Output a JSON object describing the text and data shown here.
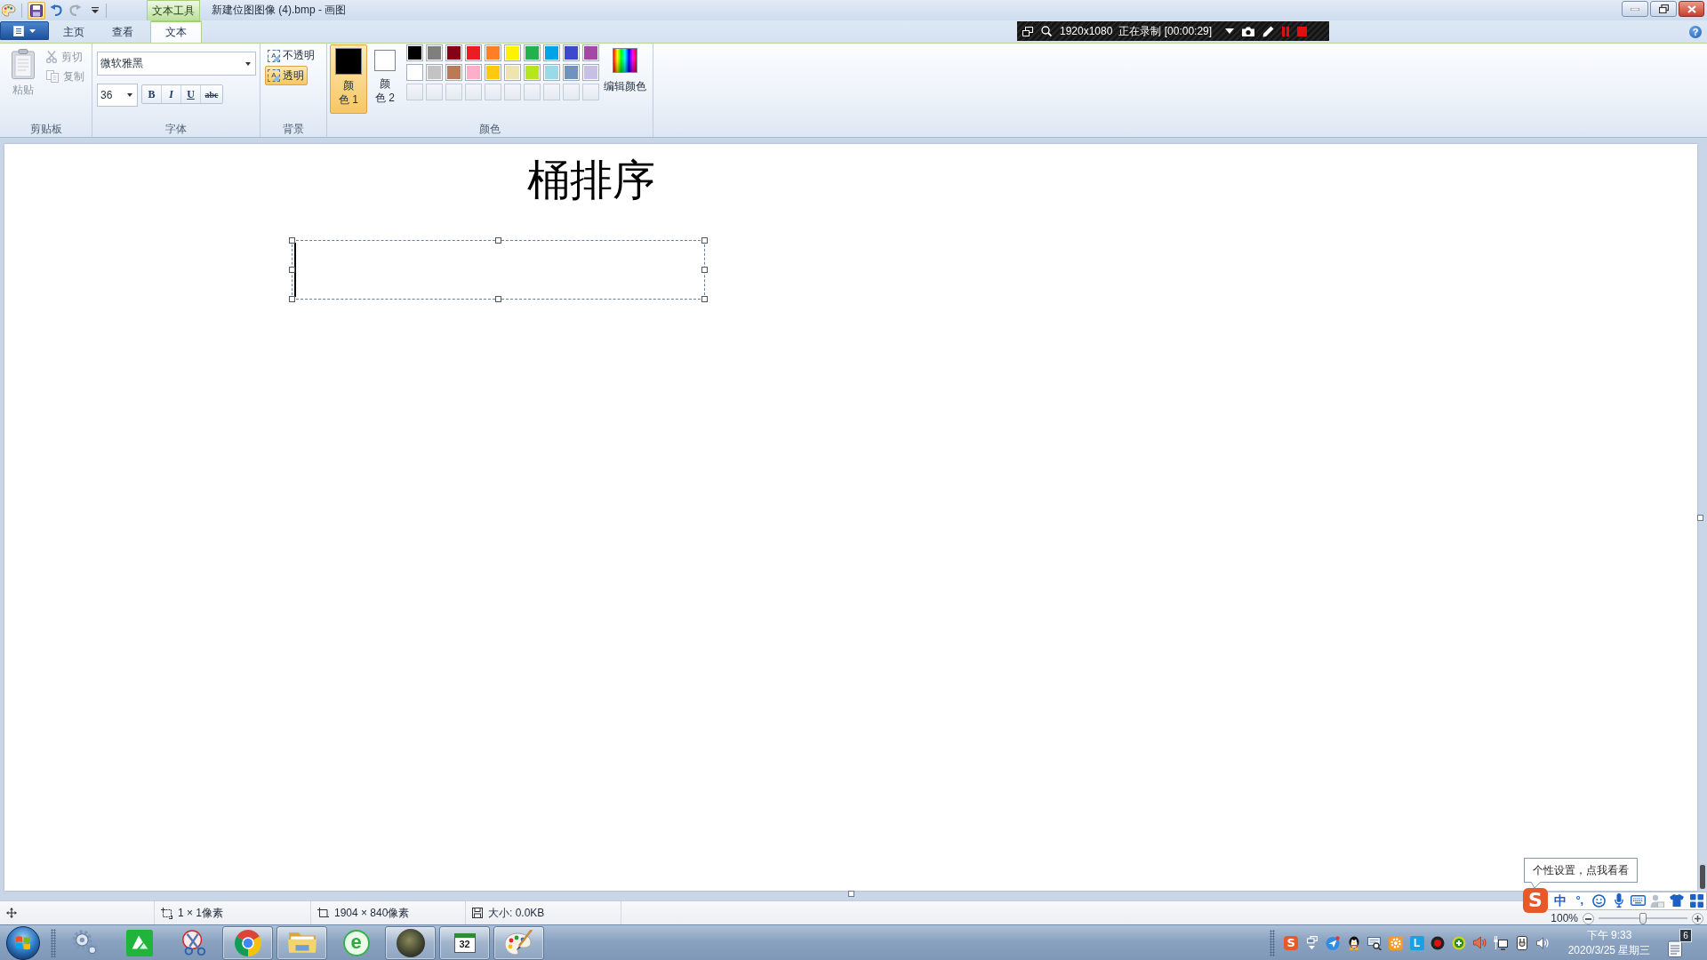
{
  "window": {
    "title": "新建位图图像 (4).bmp - 画图",
    "context_tab": "文本工具",
    "quick_access": [
      {
        "kind": "save",
        "hovered": true,
        "disabled": false
      },
      {
        "kind": "undo",
        "hovered": false,
        "disabled": false
      },
      {
        "kind": "redo",
        "hovered": false,
        "disabled": true
      },
      {
        "kind": "customize",
        "hovered": false,
        "disabled": false
      }
    ],
    "help": "?"
  },
  "tabs": [
    {
      "label": "主页",
      "selected": false,
      "contextual": false
    },
    {
      "label": "查看",
      "selected": false,
      "contextual": false
    },
    {
      "label": "文本",
      "selected": true,
      "contextual": true
    }
  ],
  "recorder": {
    "resolution": "1920x1080",
    "status": "正在录制 [00:00:29]"
  },
  "ribbon": {
    "clipboard": {
      "label": "剪贴板",
      "paste": {
        "label": "粘贴",
        "disabled": true
      },
      "actions": [
        {
          "kind": "cut",
          "label": "剪切",
          "disabled": true
        },
        {
          "kind": "copy",
          "label": "复制",
          "disabled": true
        }
      ]
    },
    "font": {
      "label": "字体",
      "family": "微软雅黑",
      "size": "36",
      "styles": [
        {
          "kind": "bold",
          "label": "B"
        },
        {
          "kind": "italic",
          "label": "I"
        },
        {
          "kind": "underline",
          "label": "U"
        },
        {
          "kind": "strike",
          "label": "abc"
        }
      ]
    },
    "background": {
      "label": "背景",
      "options": [
        {
          "label": "不透明",
          "glyph": "A",
          "selected": false
        },
        {
          "label": "透明",
          "glyph": "A",
          "selected": true
        }
      ]
    },
    "colors": {
      "label": "颜色",
      "slots": [
        {
          "label": "颜色 1",
          "color": "#000000",
          "selected": true
        },
        {
          "label": "颜色 2",
          "color": "#ffffff",
          "selected": false
        }
      ],
      "palette": [
        {
          "kind": "color",
          "color": "#000000"
        },
        {
          "kind": "color",
          "color": "#7f7f7f"
        },
        {
          "kind": "color",
          "color": "#880015"
        },
        {
          "kind": "color",
          "color": "#ed1c24"
        },
        {
          "kind": "color",
          "color": "#ff7f27"
        },
        {
          "kind": "color",
          "color": "#fff200"
        },
        {
          "kind": "color",
          "color": "#22b14c"
        },
        {
          "kind": "color",
          "color": "#00a2e8"
        },
        {
          "kind": "color",
          "color": "#3f48cc"
        },
        {
          "kind": "color",
          "color": "#a349a4"
        },
        {
          "kind": "color",
          "color": "#ffffff"
        },
        {
          "kind": "color",
          "color": "#c3c3c3"
        },
        {
          "kind": "color",
          "color": "#b97a57"
        },
        {
          "kind": "color",
          "color": "#ffaec9"
        },
        {
          "kind": "color",
          "color": "#ffc90e"
        },
        {
          "kind": "color",
          "color": "#efe4b0"
        },
        {
          "kind": "color",
          "color": "#b5e61d"
        },
        {
          "kind": "color",
          "color": "#99d9ea"
        },
        {
          "kind": "color",
          "color": "#7092be"
        },
        {
          "kind": "color",
          "color": "#c8bfe7"
        },
        {
          "kind": "empty"
        },
        {
          "kind": "empty"
        },
        {
          "kind": "empty"
        },
        {
          "kind": "empty"
        },
        {
          "kind": "empty"
        },
        {
          "kind": "empty"
        },
        {
          "kind": "empty"
        },
        {
          "kind": "empty"
        },
        {
          "kind": "empty"
        },
        {
          "kind": "empty"
        }
      ],
      "edit": "编辑颜色"
    }
  },
  "canvas": {
    "heading": "桶排序"
  },
  "status_bar": {
    "selection_size": "1 × 1像素",
    "canvas_size": "1904 × 840像素",
    "file_size": "大小: 0.0KB",
    "zoom": "100%",
    "zoom_slider": {
      "level": 0.5
    }
  },
  "ime": {
    "tooltip": "个性设置，点我看看",
    "items": [
      {
        "kind": "logo",
        "label": "S"
      },
      {
        "kind": "mode",
        "label": "中"
      },
      {
        "kind": "punct",
        "label": "°,"
      },
      {
        "kind": "smiley"
      },
      {
        "kind": "mic"
      },
      {
        "kind": "keyboard"
      },
      {
        "kind": "person"
      },
      {
        "kind": "shirt"
      },
      {
        "kind": "grid"
      }
    ]
  },
  "taskbar": {
    "apps": [
      {
        "kind": "gear",
        "running": false
      },
      {
        "kind": "tile",
        "running": false
      },
      {
        "kind": "scissors",
        "running": false
      },
      {
        "kind": "globe",
        "running": true
      },
      {
        "kind": "folder",
        "running": true
      },
      {
        "kind": "e-globe",
        "running": false,
        "label": "e"
      },
      {
        "kind": "photo",
        "running": true
      },
      {
        "kind": "calendar",
        "running": true,
        "label": "32"
      },
      {
        "kind": "palette",
        "running": true
      }
    ],
    "tray": [
      {
        "kind": "logo",
        "label": "S"
      },
      {
        "kind": "windows"
      },
      {
        "kind": "plane"
      },
      {
        "kind": "penguin"
      },
      {
        "kind": "monitor"
      },
      {
        "kind": "gear"
      },
      {
        "kind": "tile",
        "label": "L"
      },
      {
        "kind": "record"
      },
      {
        "kind": "plus"
      },
      {
        "kind": "speaker"
      },
      {
        "kind": "network"
      },
      {
        "kind": "plug"
      },
      {
        "kind": "volume"
      }
    ],
    "time": "下午 9:33",
    "date": "2020/3/25 星期三",
    "notifications": "6"
  }
}
